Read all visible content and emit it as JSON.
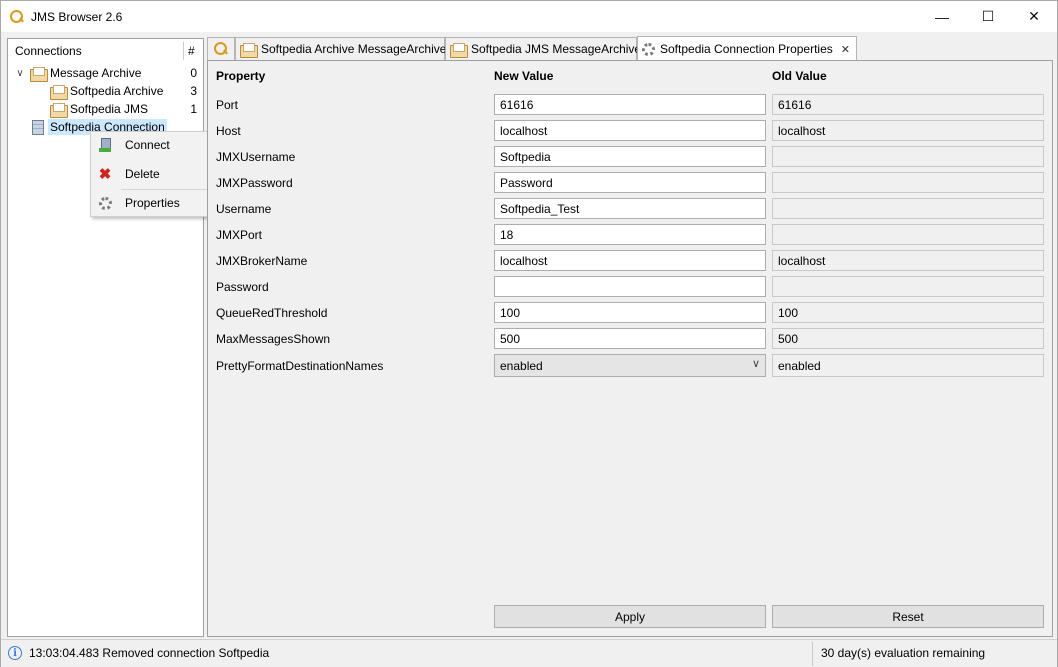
{
  "window": {
    "title": "JMS Browser 2.6"
  },
  "tree": {
    "header_name": "Connections",
    "header_count": "#",
    "items": [
      {
        "label": "Message Archive",
        "count": "0"
      },
      {
        "label": "Softpedia Archive",
        "count": "3"
      },
      {
        "label": "Softpedia JMS",
        "count": "1"
      },
      {
        "label": "Softpedia Connection",
        "count": ""
      }
    ]
  },
  "context_menu": {
    "items": [
      {
        "label": "Connect",
        "icon": "connect-icon"
      },
      {
        "label": "Delete",
        "icon": "delete-icon"
      },
      {
        "label": "Properties",
        "icon": "gear-icon"
      }
    ]
  },
  "tabs": [
    {
      "label": "",
      "icon": "search-icon"
    },
    {
      "label": "Softpedia Archive MessageArchive",
      "icon": "archive-icon"
    },
    {
      "label": "Softpedia JMS MessageArchive",
      "icon": "archive-icon"
    },
    {
      "label": "Softpedia Connection Properties",
      "icon": "gear-icon",
      "active": true
    }
  ],
  "properties": {
    "col_property": "Property",
    "col_new": "New Value",
    "col_old": "Old Value",
    "rows": [
      {
        "name": "Port",
        "new": "61616",
        "old": "61616"
      },
      {
        "name": "Host",
        "new": "localhost",
        "old": "localhost"
      },
      {
        "name": "JMXUsername",
        "new": "Softpedia",
        "old": ""
      },
      {
        "name": "JMXPassword",
        "new": "Password",
        "old": ""
      },
      {
        "name": "Username",
        "new": "Softpedia_Test",
        "old": ""
      },
      {
        "name": "JMXPort",
        "new": "18",
        "old": ""
      },
      {
        "name": "JMXBrokerName",
        "new": "localhost",
        "old": "localhost"
      },
      {
        "name": "Password",
        "new": "",
        "old": ""
      },
      {
        "name": "QueueRedThreshold",
        "new": "100",
        "old": "100"
      },
      {
        "name": "MaxMessagesShown",
        "new": "500",
        "old": "500"
      },
      {
        "name": "PrettyFormatDestinationNames",
        "new": "enabled",
        "old": "enabled"
      }
    ]
  },
  "buttons": {
    "apply": "Apply",
    "reset": "Reset"
  },
  "status": {
    "message": "13:03:04.483 Removed connection Softpedia",
    "evaluation": "30 day(s) evaluation remaining"
  }
}
